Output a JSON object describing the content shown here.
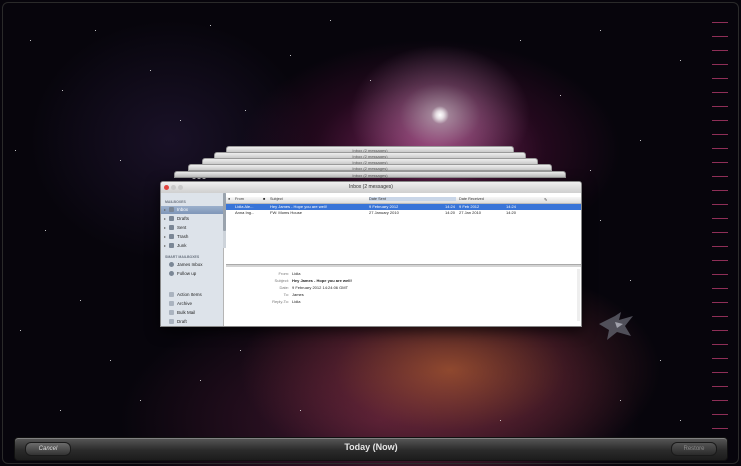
{
  "window": {
    "title": "Inbox (2 messages)",
    "ghost_titles": [
      "Inbox (2 messages)",
      "Inbox (2 messages)",
      "Inbox (2 messages)",
      "Inbox (2 messages)",
      "Inbox (2 messages)"
    ]
  },
  "sidebar": {
    "mailboxes_header": "MAILBOXES",
    "mailboxes": [
      {
        "label": "Inbox",
        "icon": "inbox-icon",
        "selected": true
      },
      {
        "label": "Drafts",
        "icon": "drafts-icon"
      },
      {
        "label": "Sent",
        "icon": "sent-icon"
      },
      {
        "label": "Trash",
        "icon": "trash-icon"
      },
      {
        "label": "Junk",
        "icon": "junk-icon"
      }
    ],
    "smart_header": "SMART MAILBOXES",
    "smart": [
      {
        "label": "James Inbox",
        "icon": "gear-icon"
      },
      {
        "label": "Follow up",
        "icon": "gear-icon"
      }
    ],
    "folders": [
      {
        "label": "Action Items",
        "icon": "folder-icon"
      },
      {
        "label": "Archive",
        "icon": "folder-icon"
      },
      {
        "label": "Bulk Mail",
        "icon": "folder-icon"
      },
      {
        "label": "Draft",
        "icon": "folder-icon"
      }
    ]
  },
  "message_list": {
    "columns": {
      "from": "From",
      "subject": "Subject",
      "date_sent": "Date Sent",
      "date_received": "Date Received"
    },
    "rows": [
      {
        "from": "Lidia Ale...",
        "subject": "Hey James - Hope you are well!",
        "date_sent": "9 February 2012",
        "sent_time": "14:24",
        "date_received": "9 Feb 2012",
        "received_time": "14:24",
        "selected": true
      },
      {
        "from": "Anna Ing...",
        "subject": "FW: Moms House",
        "date_sent": "27 January 2010",
        "sent_time": "14:20",
        "date_received": "27 Jan 2010",
        "received_time": "14:20",
        "selected": false
      }
    ]
  },
  "preview": {
    "from_label": "From:",
    "from": "Lidia",
    "subject_label": "Subject:",
    "subject": "Hey James - Hope you are well!",
    "date_label": "Date:",
    "date": "9 February 2012 14:24:06 GMT",
    "to_label": "To:",
    "to": "James",
    "replyto_label": "Reply-To:",
    "replyto": "Lidia"
  },
  "bottom_bar": {
    "cancel": "Cancel",
    "today": "Today (Now)",
    "restore": "Restore"
  }
}
